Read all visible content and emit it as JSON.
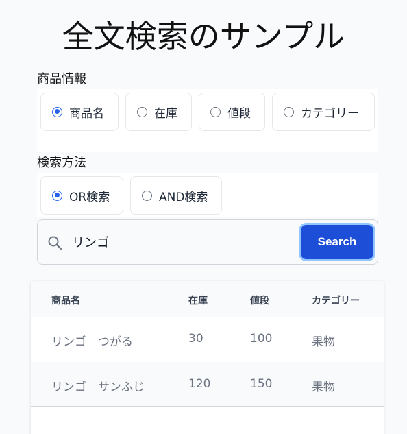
{
  "page": {
    "title": "全文検索のサンプル"
  },
  "product_info": {
    "label": "商品情報",
    "options": [
      {
        "label": "商品名",
        "checked": true
      },
      {
        "label": "在庫",
        "checked": false
      },
      {
        "label": "値段",
        "checked": false
      },
      {
        "label": "カテゴリー",
        "checked": false
      }
    ]
  },
  "search_method": {
    "label": "検索方法",
    "options": [
      {
        "label": "OR検索",
        "checked": true
      },
      {
        "label": "AND検索",
        "checked": false
      }
    ]
  },
  "search": {
    "value": "リンゴ",
    "button_label": "Search",
    "icon": "search-icon"
  },
  "table": {
    "headers": [
      "商品名",
      "在庫",
      "値段",
      "カテゴリー"
    ],
    "rows": [
      [
        "リンゴ　つがる",
        "30",
        "100",
        "果物"
      ],
      [
        "リンゴ　サンふじ",
        "120",
        "150",
        "果物"
      ]
    ]
  },
  "colors": {
    "accent": "#2563eb",
    "button": "#1d4ed8",
    "button_ring": "#93c5fd"
  }
}
